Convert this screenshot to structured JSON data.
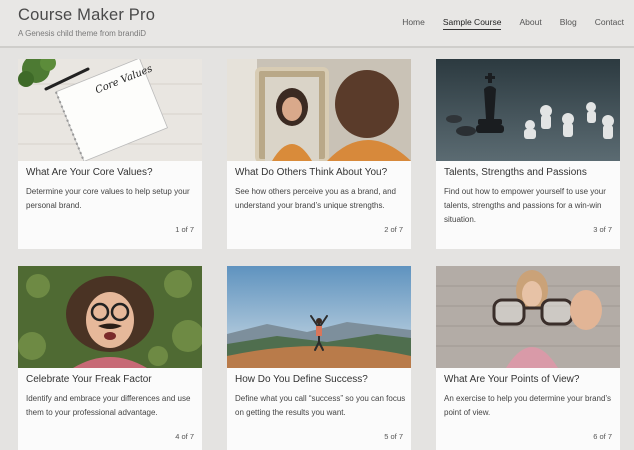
{
  "site": {
    "title": "Course Maker Pro",
    "description": "A Genesis child theme from brandiD"
  },
  "nav": [
    "Home",
    "Sample Course",
    "About",
    "Blog",
    "Contact"
  ],
  "nav_active": "Sample Course",
  "cards": [
    {
      "title": "What Are Your Core Values?",
      "text": "Determine your core values to help setup your personal brand.",
      "count": "1 of 7",
      "image_text": "Core Values"
    },
    {
      "title": "What Do Others Think About You?",
      "text": "See how others perceive you as a brand, and understand your brand’s unique strengths.",
      "count": "2 of 7"
    },
    {
      "title": "Talents, Strengths and Passions",
      "text": "Find out how to empower yourself to use your talents, strengths and passions for a win-win situation.",
      "count": "3 of 7"
    },
    {
      "title": "Celebrate Your Freak Factor",
      "text": "Identify and embrace your differences and use them to your professional advantage.",
      "count": "4 of 7"
    },
    {
      "title": "How Do You Define Success?",
      "text": "Define what you call “success” so you can focus on getting the results you want.",
      "count": "5 of 7"
    },
    {
      "title": "What Are Your Points of View?",
      "text": "An exercise to help you determine your brand’s point of view.",
      "count": "6 of 7"
    }
  ]
}
